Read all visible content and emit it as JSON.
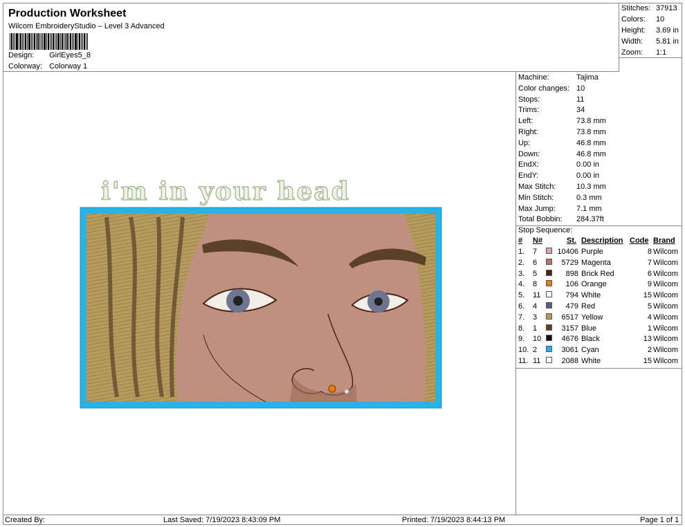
{
  "header": {
    "title": "Production Worksheet",
    "software": "Wilcom EmbroideryStudio – Level 3 Advanced",
    "design_label": "Design:",
    "design_value": "GirlEyes5_8",
    "colorway_label": "Colorway:",
    "colorway_value": "Colorway 1"
  },
  "stats": [
    {
      "label": "Stitches:",
      "value": "37913"
    },
    {
      "label": "Colors:",
      "value": "10"
    },
    {
      "label": "Height:",
      "value": "3.69 in"
    },
    {
      "label": "Width:",
      "value": "5.81 in"
    },
    {
      "label": "Zoom:",
      "value": "1:1"
    }
  ],
  "design_text": "i'm in your head",
  "machine_info": [
    {
      "label": "Machine:",
      "value": "Tajima"
    },
    {
      "label": "Color changes:",
      "value": "10"
    },
    {
      "label": "Stops:",
      "value": "11"
    },
    {
      "label": "Trims:",
      "value": "34"
    },
    {
      "label": "Left:",
      "value": "73.8 mm"
    },
    {
      "label": "Right:",
      "value": "73.8 mm"
    },
    {
      "label": "Up:",
      "value": "46.8 mm"
    },
    {
      "label": "Down:",
      "value": "46.8 mm"
    },
    {
      "label": "EndX:",
      "value": "0.00 in"
    },
    {
      "label": "EndY:",
      "value": "0.00 in"
    },
    {
      "label": "Max Stitch:",
      "value": "10.3 mm"
    },
    {
      "label": "Min Stitch:",
      "value": "0.3 mm"
    },
    {
      "label": "Max Jump:",
      "value": "7.1 mm"
    },
    {
      "label": "Total Bobbin:",
      "value": "284.37ft"
    }
  ],
  "stop_sequence": {
    "title": "Stop Sequence:",
    "headers": {
      "idx": "#",
      "n": "N#",
      "st": "St.",
      "desc": "Description",
      "code": "Code",
      "brand": "Brand"
    },
    "rows": [
      {
        "idx": "1.",
        "n": "7",
        "color": "#d8a6a6",
        "st": "10406",
        "desc": "Purple",
        "code": "8",
        "brand": "Wilcom"
      },
      {
        "idx": "2.",
        "n": "6",
        "color": "#b0766a",
        "st": "5729",
        "desc": "Magenta",
        "code": "7",
        "brand": "Wilcom"
      },
      {
        "idx": "3.",
        "n": "5",
        "color": "#4a2418",
        "st": "898",
        "desc": "Brick Red",
        "code": "6",
        "brand": "Wilcom"
      },
      {
        "idx": "4.",
        "n": "8",
        "color": "#e87e12",
        "st": "106",
        "desc": "Orange",
        "code": "9",
        "brand": "Wilcom"
      },
      {
        "idx": "5.",
        "n": "11",
        "color": "#ffffff",
        "st": "794",
        "desc": "White",
        "code": "15",
        "brand": "Wilcom"
      },
      {
        "idx": "6.",
        "n": "4",
        "color": "#5c5f78",
        "st": "479",
        "desc": "Red",
        "code": "5",
        "brand": "Wilcom"
      },
      {
        "idx": "7.",
        "n": "3",
        "color": "#b59b5e",
        "st": "6517",
        "desc": "Yellow",
        "code": "4",
        "brand": "Wilcom"
      },
      {
        "idx": "8.",
        "n": "1",
        "color": "#5a4128",
        "st": "3157",
        "desc": "Blue",
        "code": "1",
        "brand": "Wilcom"
      },
      {
        "idx": "9.",
        "n": "10",
        "color": "#111111",
        "st": "4676",
        "desc": "Black",
        "code": "13",
        "brand": "Wilcom"
      },
      {
        "idx": "10.",
        "n": "2",
        "color": "#2ab2e6",
        "st": "3061",
        "desc": "Cyan",
        "code": "2",
        "brand": "Wilcom"
      },
      {
        "idx": "11.",
        "n": "11",
        "color": "#ffffff",
        "st": "2088",
        "desc": "White",
        "code": "15",
        "brand": "Wilcom"
      }
    ]
  },
  "footer": {
    "created_by": "Created By:",
    "last_saved": "Last Saved: 7/19/2023 8:43:09 PM",
    "printed": "Printed: 7/19/2023 8:44:13 PM",
    "page": "Page 1 of 1"
  },
  "colors": {
    "frame_cyan": "#2ab2e6",
    "skin": "#c09080",
    "hair": "#b59b5e"
  }
}
